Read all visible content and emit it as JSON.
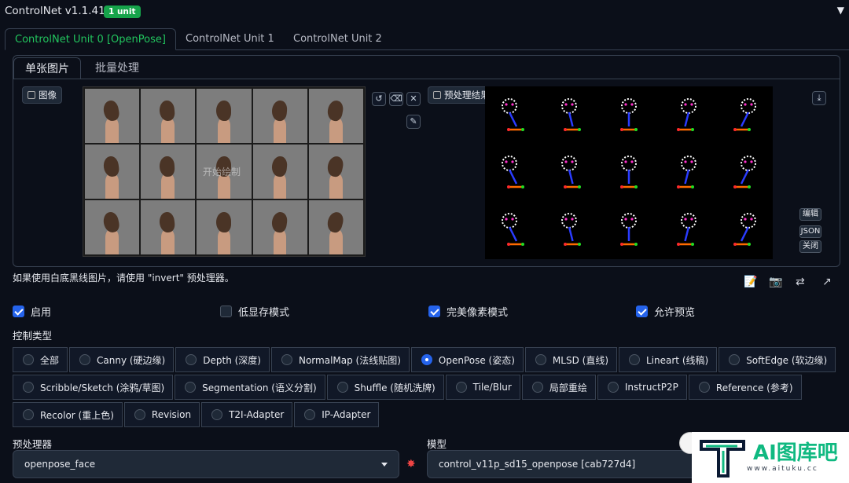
{
  "header": {
    "title": "ControlNet v1.1.410",
    "badge": "1 unit",
    "collapse_icon": "triangle-down"
  },
  "unit_tabs": [
    {
      "label": "ControlNet Unit 0 [OpenPose]",
      "active": true
    },
    {
      "label": "ControlNet Unit 1",
      "active": false
    },
    {
      "label": "ControlNet Unit 2",
      "active": false
    }
  ],
  "image_tabs": [
    {
      "label": "单张图片",
      "active": true
    },
    {
      "label": "批量处理",
      "active": false
    }
  ],
  "input_image": {
    "label": "图像",
    "overlay_text": "开始绘制"
  },
  "input_tools": [
    "rotate-icon",
    "erase-icon",
    "close-icon",
    "edit-icon"
  ],
  "preview": {
    "label": "预处理结果预览",
    "download_icon": "download-icon",
    "buttons": [
      "编辑",
      "JSON",
      "关闭"
    ]
  },
  "hint": "如果使用白底黑线图片，请使用 \"invert\" 预处理器。",
  "action_icons": [
    "doc-icon",
    "camera-icon",
    "swap-icon",
    "send-up-icon"
  ],
  "checkboxes": [
    {
      "label": "启用",
      "checked": true
    },
    {
      "label": "低显存模式",
      "checked": false
    },
    {
      "label": "完美像素模式",
      "checked": true
    },
    {
      "label": "允许预览",
      "checked": true
    }
  ],
  "control_type": {
    "label": "控制类型",
    "rows": [
      [
        "全部",
        "Canny (硬边缘)",
        "Depth (深度)",
        "NormalMap (法线贴图)",
        "OpenPose (姿态)",
        "MLSD (直线)",
        "Lineart (线稿)",
        "SoftEdge (软边缘)"
      ],
      [
        "Scribble/Sketch (涂鸦/草图)",
        "Segmentation (语义分割)",
        "Shuffle (随机洗牌)",
        "Tile/Blur",
        "局部重绘",
        "InstructP2P",
        "Reference (参考)"
      ],
      [
        "Recolor (重上色)",
        "Revision",
        "T2I-Adapter",
        "IP-Adapter"
      ]
    ],
    "selected": "OpenPose (姿态)"
  },
  "preprocessor": {
    "label": "预处理器",
    "value": "openpose_face"
  },
  "model": {
    "label": "模型",
    "value": "control_v11p_sd15_openpose [cab727d4]"
  },
  "watermark": {
    "brand": "AI图库吧",
    "url": "www.aituku.cc"
  },
  "colors": {
    "accent": "#22c55e",
    "selected": "#2563eb",
    "background": "#0b0f19",
    "border": "#374151"
  }
}
